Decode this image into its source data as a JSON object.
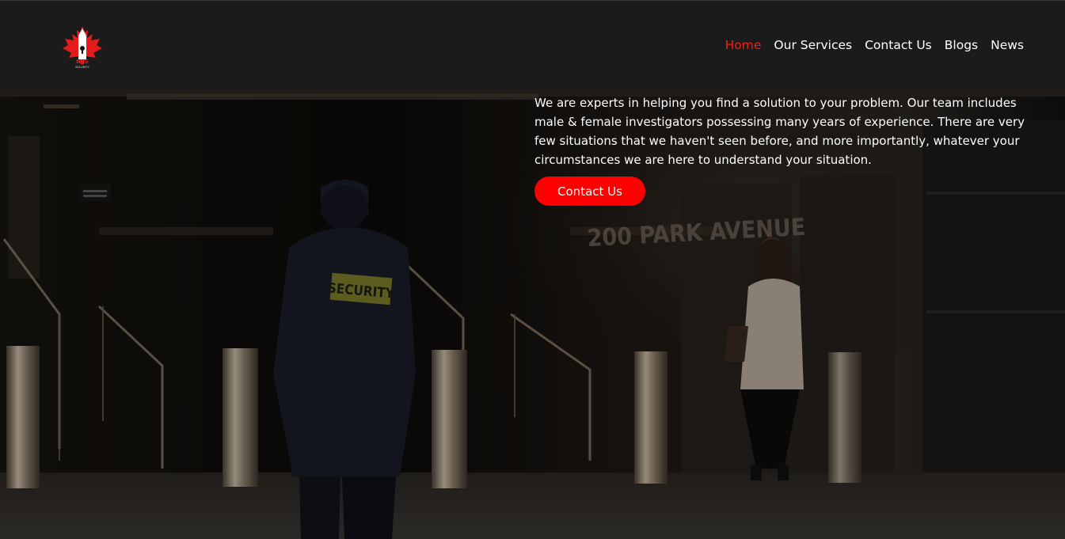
{
  "header": {
    "logo": {
      "icon": "maple-leaf-icon",
      "letters": "NSS",
      "tagline": "SECURITY",
      "leaf_color": "#e31b1b"
    },
    "nav": [
      {
        "label": "Home",
        "active": true
      },
      {
        "label": "Our Services",
        "active": false
      },
      {
        "label": "Contact Us",
        "active": false
      },
      {
        "label": "Blogs",
        "active": false
      },
      {
        "label": "News",
        "active": false
      }
    ],
    "active_color": "#ff1a1a"
  },
  "hero": {
    "description": "We are experts in helping you find a solution to your problem. Our team includes male & female investigators possessing many years of experience. There are very few situations that we haven't seen before, and more importantly, whatever your circumstances we are here to understand your situation.",
    "cta_label": "Contact Us",
    "cta_color": "#ff0000",
    "photo": {
      "guard_patch": "SECURITY",
      "wall_sign": "200 PARK AVENUE"
    }
  }
}
